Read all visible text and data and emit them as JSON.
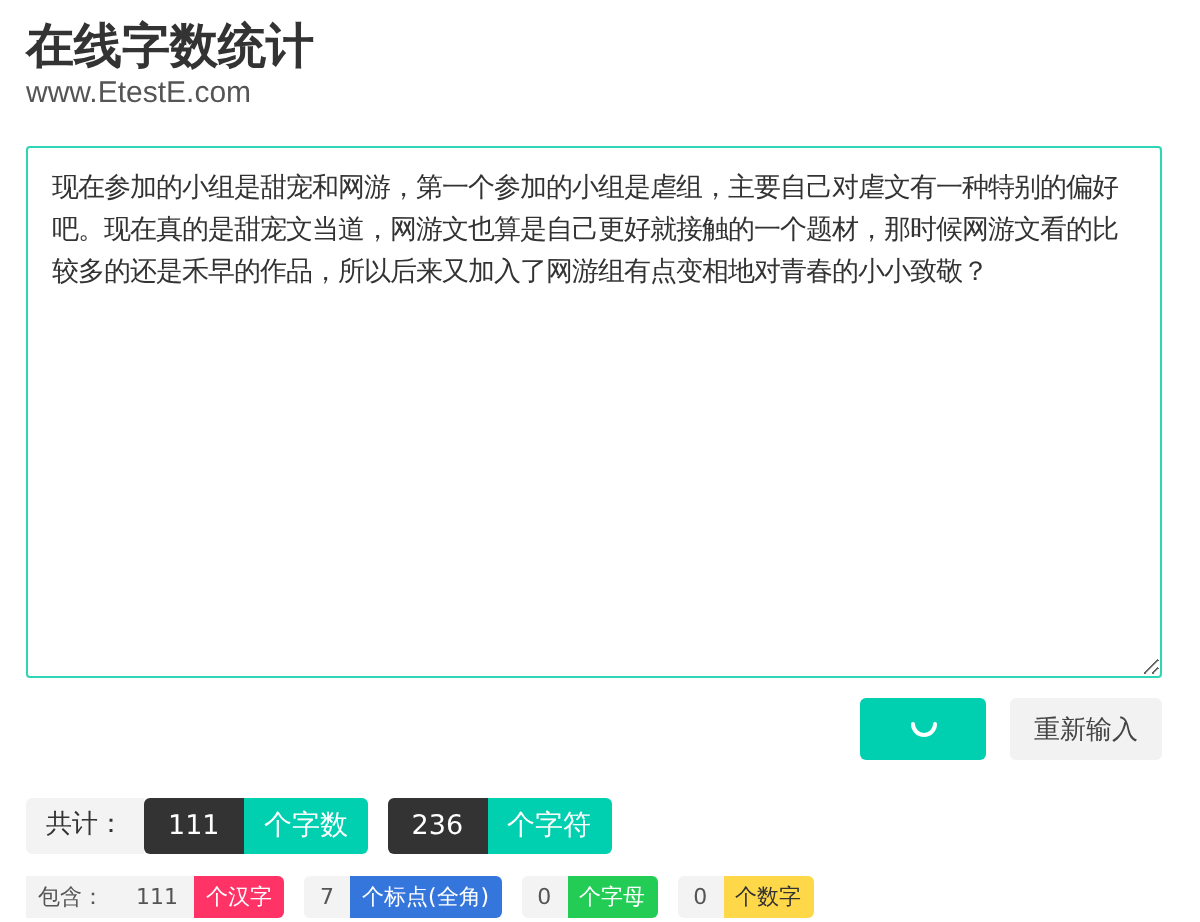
{
  "header": {
    "title": "在线字数统计",
    "subtitle": "www.EtestE.com"
  },
  "editor": {
    "value": "现在参加的小组是甜宠和网游，第一个参加的小组是虐组，主要自己对虐文有一种特别的偏好吧。现在真的是甜宠文当道，网游文也算是自己更好就接触的一个题材，那时候网游文看的比较多的还是禾早的作品，所以后来又加入了网游组有点变相地对青春的小小致敬？"
  },
  "buttons": [
    {
      "kind": "loading"
    },
    {
      "kind": "text",
      "label": "重新输入"
    }
  ],
  "totals": {
    "label": "共计：",
    "items": [
      {
        "count": "111",
        "unit": "个字数"
      },
      {
        "count": "236",
        "unit": "个字符"
      }
    ]
  },
  "details": {
    "label": "包含：",
    "items": [
      {
        "count": "111",
        "unit": "个汉字",
        "color": "#ff3366"
      },
      {
        "count": "7",
        "unit": "个标点(全角)",
        "color": "#3576dc"
      },
      {
        "count": "0",
        "unit": "个字母",
        "color": "#22cc55"
      },
      {
        "count": "0",
        "unit": "个数字",
        "color": "#ffd84a"
      }
    ]
  }
}
